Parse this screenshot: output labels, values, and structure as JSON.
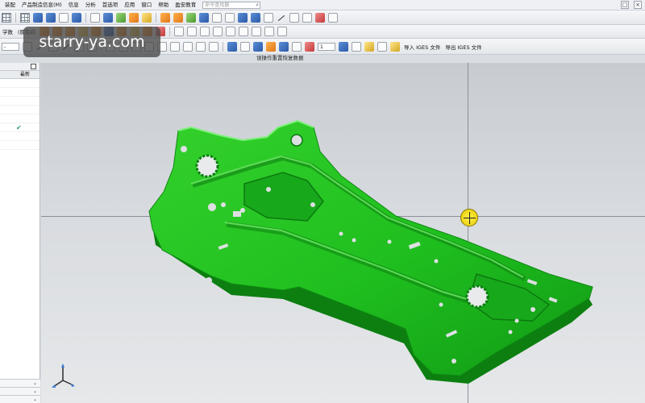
{
  "menu": {
    "items": [
      "装配",
      "产品制造信息(M)",
      "信息",
      "分析",
      "首选项",
      "应用",
      "窗口",
      "帮助",
      "盈安教育"
    ],
    "search_placeholder": "命令查找器"
  },
  "window_controls": [
    "□",
    "×"
  ],
  "toolbar2": {
    "left_text": "学数",
    "filter_text": "(原有向",
    "select_value": "-"
  },
  "toolbar3": {
    "layer_value": "1",
    "import_label": "导入 IGES 文件",
    "export_label": "导出 IGES 文件"
  },
  "viewport": {
    "caption": "误操作重置恢复数据"
  },
  "left_panel": {
    "column_header": "最新",
    "checked_row_index": 6
  },
  "watermark": {
    "text": "starry-ya.com"
  },
  "colors": {
    "part": "#1fbf1f",
    "part_dark": "#0f8a12",
    "part_highlight": "#5fe05a",
    "viewport_top": "#c8ccd1",
    "viewport_bottom": "#e6e8ea",
    "marker": "#f3dc1c"
  },
  "icons": [
    "grid-icon",
    "box-icon",
    "sketch-icon",
    "extrude-icon",
    "hole-icon",
    "line-icon",
    "arc-icon",
    "circle-icon",
    "point-icon",
    "mirror-icon",
    "snap-icon",
    "view-triad-icon",
    "crosshair-marker-icon"
  ]
}
